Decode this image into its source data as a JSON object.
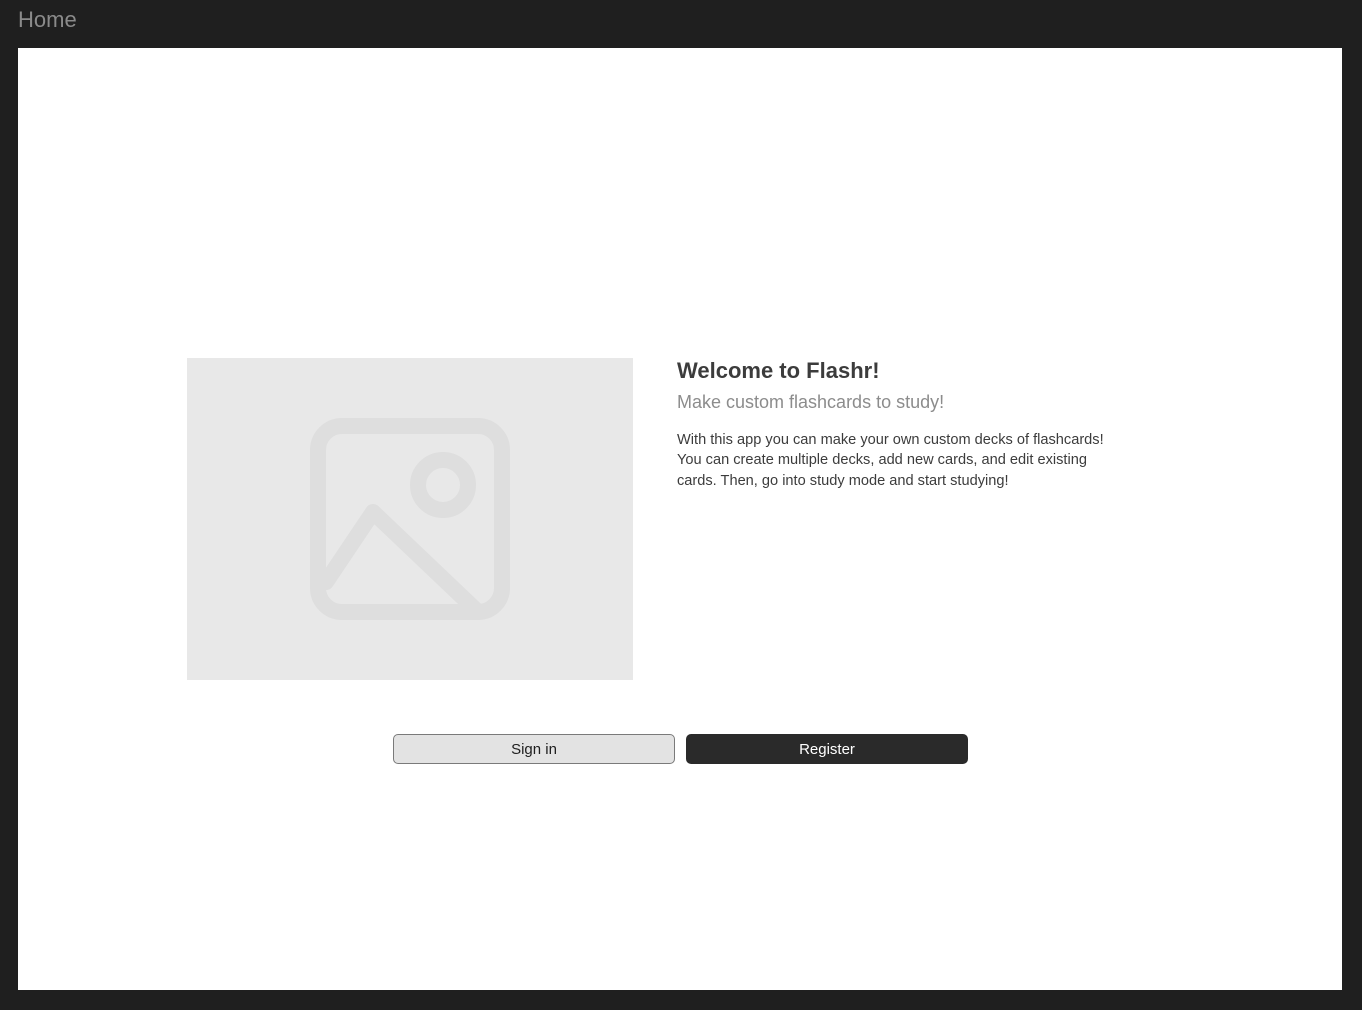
{
  "frame": {
    "label": "Home"
  },
  "hero": {
    "image_icon": "image-placeholder-icon",
    "title": "Welcome to Flashr!",
    "subtitle": "Make custom flashcards to study!",
    "description": "With this app you can make your own custom decks of flashcards! You can create multiple decks, add new cards, and edit existing cards. Then, go into study mode and start studying!"
  },
  "actions": {
    "sign_in_label": "Sign in",
    "register_label": "Register"
  },
  "colors": {
    "background": "#1f1f1f",
    "canvas": "#ffffff",
    "placeholder": "#e8e8e8",
    "primary_button": "#2a2a2a",
    "secondary_button": "#e3e3e3"
  }
}
